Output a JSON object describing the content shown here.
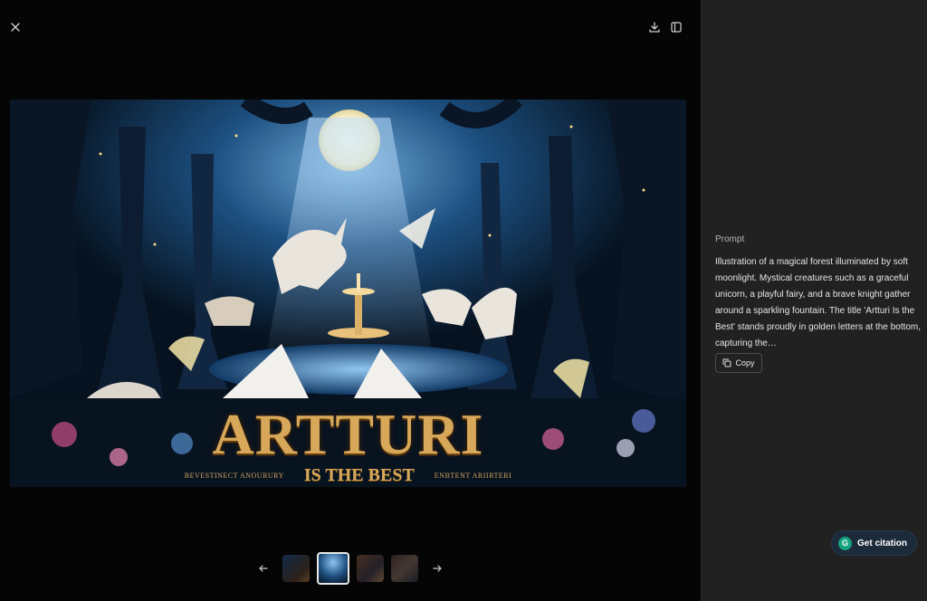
{
  "viewer": {
    "close_icon": "close-icon",
    "download_icon": "download-icon",
    "sidebar_icon": "sidebar-toggle-icon",
    "image": {
      "title": "ARTTURI",
      "subtitle": "IS THE BEST",
      "small_left": "BEVESTINECT ANOURURY",
      "small_right": "ENBTENT ARIIRTERI"
    },
    "thumbnails": {
      "count": 4,
      "active_index": 1
    },
    "prev_icon": "arrow-left-icon",
    "next_icon": "arrow-right-icon"
  },
  "panel": {
    "prompt_label": "Prompt",
    "prompt_text": "Illustration of a magical forest illuminated by soft moonlight. Mystical creatures such as a graceful unicorn, a playful fairy, and a brave knight gather around a sparkling fountain. The title 'Artturi Is the Best' stands proudly in golden letters at the bottom, capturing the…",
    "copy_label": "Copy"
  },
  "citation": {
    "label": "Get citation",
    "logo": "G"
  },
  "colors": {
    "title_gold": "#d7a85a",
    "panel_bg": "#212121",
    "citation_green": "#15a37f"
  }
}
